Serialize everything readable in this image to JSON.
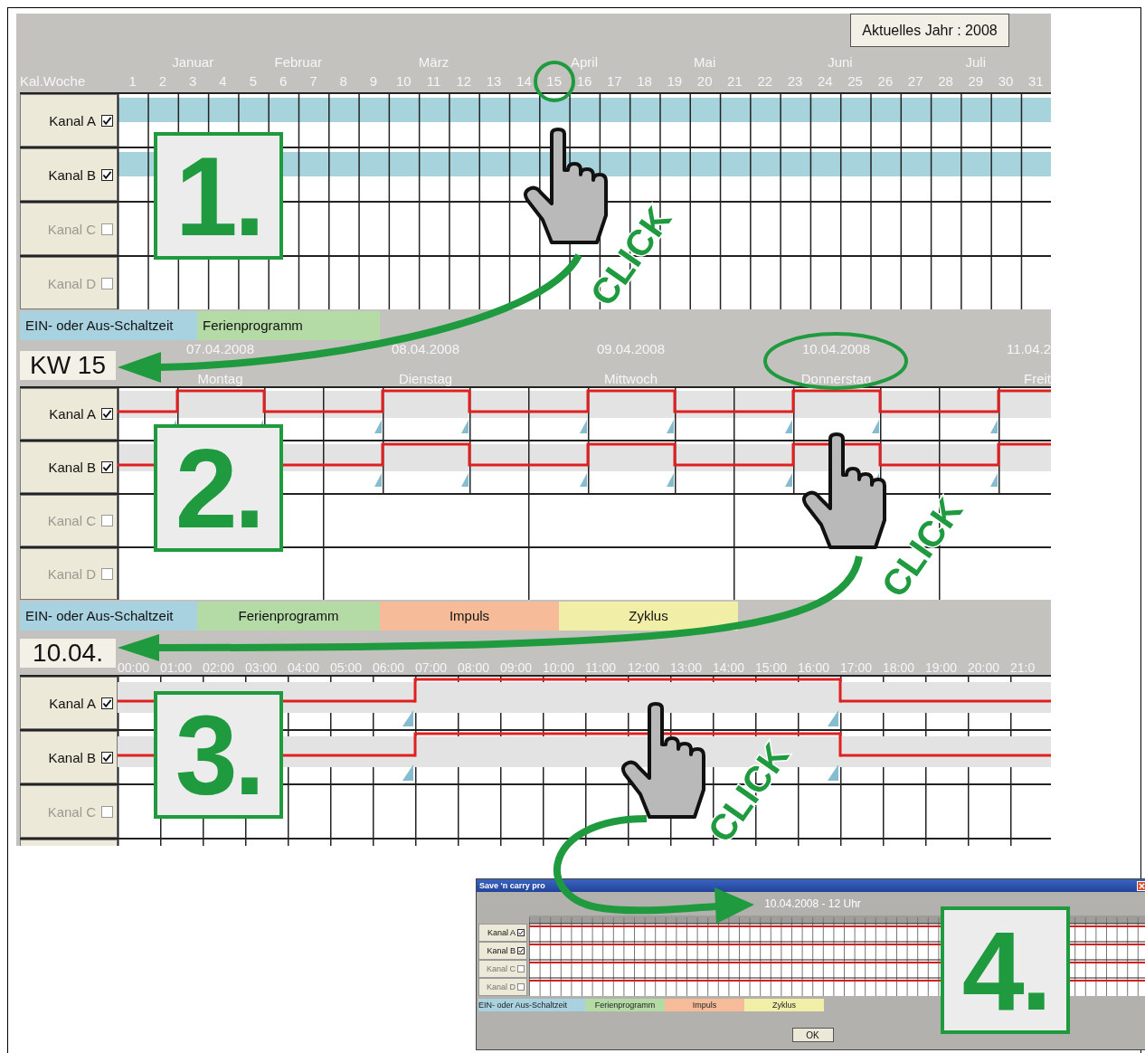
{
  "year_view": {
    "year_label": "Aktuelles Jahr : 2008",
    "corner_label": "Kal.Woche",
    "months": [
      "Januar",
      "Februar",
      "März",
      "April",
      "Mai",
      "Juni",
      "Juli"
    ],
    "weeks": [
      "1",
      "2",
      "3",
      "4",
      "5",
      "6",
      "7",
      "8",
      "9",
      "10",
      "11",
      "12",
      "13",
      "14",
      "15",
      "16",
      "17",
      "18",
      "19",
      "20",
      "21",
      "22",
      "23",
      "24",
      "25",
      "26",
      "27",
      "28",
      "29",
      "30",
      "31"
    ],
    "channels": [
      {
        "name": "Kanal A",
        "checked": true
      },
      {
        "name": "Kanal B",
        "checked": true
      },
      {
        "name": "Kanal C",
        "checked": false
      },
      {
        "name": "Kanal D",
        "checked": false
      }
    ]
  },
  "legend_top": [
    {
      "label": "EIN- oder Aus-Schaltzeit",
      "color": "#a8d2e0"
    },
    {
      "label": "Ferienprogramm",
      "color": "#b4dba5"
    }
  ],
  "week_view": {
    "week_label": "KW 15",
    "days": [
      {
        "date": "07.04.2008",
        "weekday": "Montag"
      },
      {
        "date": "08.04.2008",
        "weekday": "Dienstag"
      },
      {
        "date": "09.04.2008",
        "weekday": "Mittwoch"
      },
      {
        "date": "10.04.2008",
        "weekday": "Donnerstag"
      },
      {
        "date": "11.04.2",
        "weekday": "Freit"
      }
    ],
    "channels": [
      {
        "name": "Kanal A",
        "checked": true,
        "pulses": [
          true,
          true,
          true,
          true,
          true
        ]
      },
      {
        "name": "Kanal B",
        "checked": true,
        "pulses": [
          false,
          true,
          true,
          true,
          true
        ]
      },
      {
        "name": "Kanal C",
        "checked": false
      },
      {
        "name": "Kanal D",
        "checked": false
      }
    ]
  },
  "legend_middle": [
    {
      "label": "EIN- oder Aus-Schaltzeit",
      "color": "#a8d2e0"
    },
    {
      "label": "Ferienprogramm",
      "color": "#b4dba5"
    },
    {
      "label": "Impuls",
      "color": "#f6bc9a"
    },
    {
      "label": "Zyklus",
      "color": "#f1eea8"
    }
  ],
  "day_view": {
    "day_label": "10.04.",
    "hours": [
      "00:00",
      "01:00",
      "02:00",
      "03:00",
      "04:00",
      "05:00",
      "06:00",
      "07:00",
      "08:00",
      "09:00",
      "10:00",
      "11:00",
      "12:00",
      "13:00",
      "14:00",
      "15:00",
      "16:00",
      "17:00",
      "18:00",
      "19:00",
      "20:00",
      "21:0"
    ],
    "channels": [
      {
        "name": "Kanal A",
        "checked": true,
        "on": [
          false,
          false,
          false,
          false,
          false,
          false,
          false,
          true,
          true,
          true,
          true,
          true,
          true,
          true,
          true,
          true,
          true,
          false,
          false,
          false,
          false,
          false
        ]
      },
      {
        "name": "Kanal B",
        "checked": true,
        "on": [
          false,
          false,
          false,
          false,
          false,
          false,
          false,
          true,
          true,
          true,
          true,
          true,
          true,
          true,
          true,
          true,
          true,
          false,
          false,
          false,
          false,
          false
        ]
      },
      {
        "name": "Kanal C",
        "checked": false
      }
    ]
  },
  "dialog": {
    "title": "Save 'n carry pro",
    "subtitle": "10.04.2008 - 12 Uhr",
    "channels": [
      {
        "name": "Kanal A",
        "checked": true
      },
      {
        "name": "Kanal B",
        "checked": true
      },
      {
        "name": "Kanal C",
        "checked": false
      },
      {
        "name": "Kanal D",
        "checked": false
      }
    ],
    "legend": [
      {
        "label": "EIN- oder Aus-Schaltzeit",
        "color": "#a8d2e0"
      },
      {
        "label": "Ferienprogramm",
        "color": "#b4dba5"
      },
      {
        "label": "Impuls",
        "color": "#f6bc9a"
      },
      {
        "label": "Zyklus",
        "color": "#f1eea8"
      }
    ],
    "ok_label": "OK"
  },
  "annotations": {
    "steps": [
      "1.",
      "2.",
      "3.",
      "4."
    ],
    "click_labels": [
      "CLICK",
      "CLICK",
      "CLICK"
    ]
  }
}
